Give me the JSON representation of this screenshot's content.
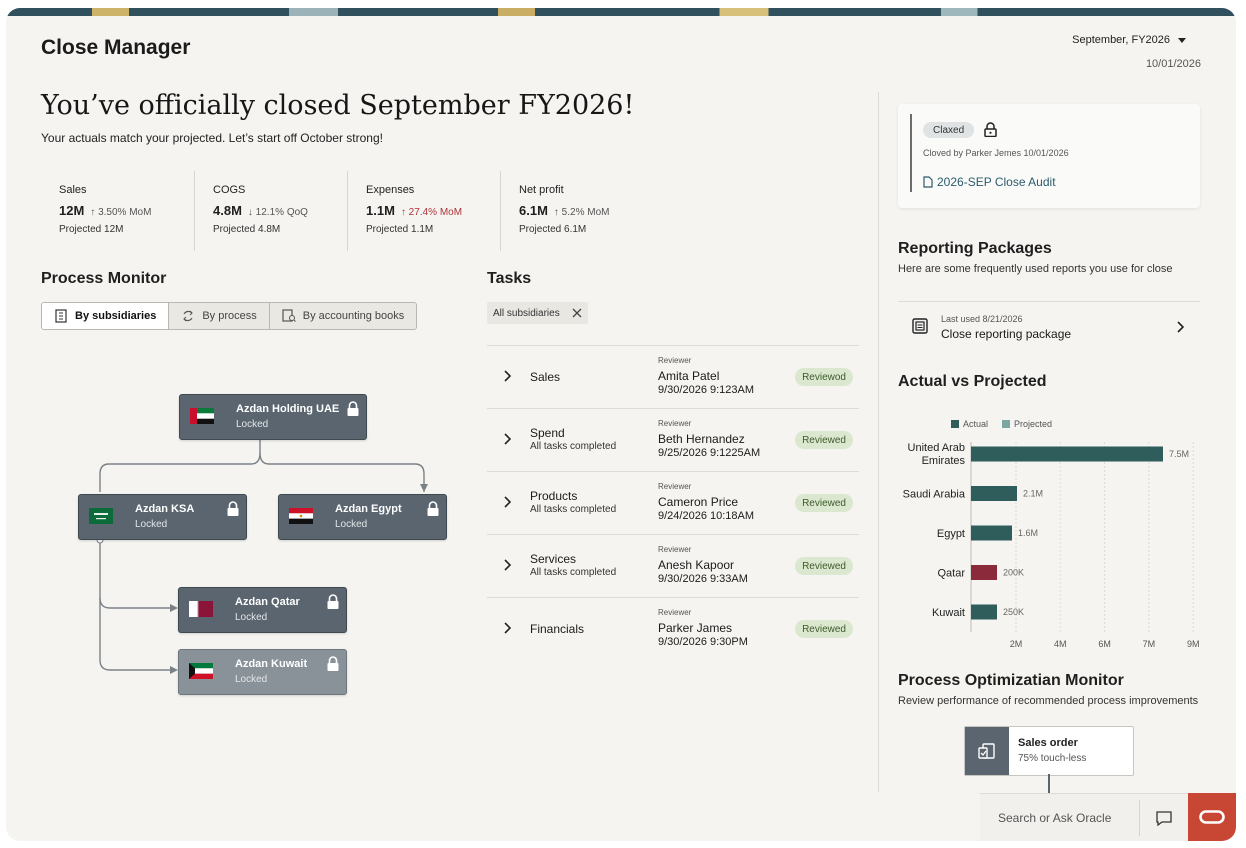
{
  "app": {
    "title": "Close Manager",
    "period": "September, FY2026",
    "date": "10/01/2026"
  },
  "hero": {
    "headline": "You’ve officially closed September FY2026!",
    "subhead": "Your actuals match your projected. Let’s start off October strong!"
  },
  "kpis": [
    {
      "label": "Sales",
      "value": "12M",
      "change": "↑ 3.50% MoM",
      "projected": "Projected 12M",
      "negative": false
    },
    {
      "label": "COGS",
      "value": "4.8M",
      "change": "↓ 12.1% QoQ",
      "projected": "Projected 4.8M",
      "negative": false
    },
    {
      "label": "Expenses",
      "value": "1.1M",
      "change": "↑ 27.4% MoM",
      "projected": "Projected 1.1M",
      "negative": true
    },
    {
      "label": "Net profit",
      "value": "6.1M",
      "change": "↑ 5.2% MoM",
      "projected": "Projected 6.1M",
      "negative": false
    }
  ],
  "process_monitor": {
    "title": "Process Monitor",
    "tabs": [
      "By subsidiaries",
      "By process",
      "By accounting books"
    ],
    "nodes": {
      "uae": {
        "name": "Azdan Holding UAE",
        "status": "Locked"
      },
      "ksa": {
        "name": "Azdan KSA",
        "status": "Locked"
      },
      "egypt": {
        "name": "Azdan Egypt",
        "status": "Locked"
      },
      "qatar": {
        "name": "Azdan Qatar",
        "status": "Locked"
      },
      "kuwait": {
        "name": "Azdan Kuwait",
        "status": "Locked"
      }
    }
  },
  "tasks": {
    "title": "Tasks",
    "filter": "All subsidiaries",
    "rows": [
      {
        "name": "Sales",
        "sub": "",
        "reviewer_label": "Reviewer",
        "reviewer": "Amita Patel",
        "date": "9/30/2026 9:123AM",
        "status": "Reviewod"
      },
      {
        "name": "Spend",
        "sub": "All tasks completed",
        "reviewer_label": "Reviewer",
        "reviewer": "Beth Hernandez",
        "date": "9/25/2026 9:1225AM",
        "status": "Reviewed"
      },
      {
        "name": "Products",
        "sub": "All tasks completed",
        "reviewer_label": "Reviewer",
        "reviewer": "Cameron Price",
        "date": "9/24/2026 10:18AM",
        "status": "Reviewed"
      },
      {
        "name": "Services",
        "sub": "All tasks completed",
        "reviewer_label": "Reviewer",
        "reviewer": "Anesh Kapoor",
        "date": "9/30/2026 9:33AM",
        "status": "Reviewed"
      },
      {
        "name": "Financials",
        "sub": "",
        "reviewer_label": "Reviewer",
        "reviewer": "Parker James",
        "date": "9/30/2026 9:30PM",
        "status": "Reviewed"
      }
    ]
  },
  "close_card": {
    "status": "Claxed",
    "by": "Cloved by Parker Jemes 10/01/2026",
    "doc": "2026-SEP Close Audit"
  },
  "reporting": {
    "title": "Reporting Packages",
    "subtitle": "Here are some frequently used reports you use for close",
    "item": {
      "last_used": "Last used 8/21/2026",
      "name": "Close reporting package"
    }
  },
  "chart_title": "Actual vs Projected",
  "chart_data": {
    "type": "bar",
    "orientation": "horizontal",
    "legend": [
      "Actual",
      "Projected"
    ],
    "legend_placement": "top",
    "categories": [
      "United Arab Emirates",
      "Saudi Arabia",
      "Egypt",
      "Qatar",
      "Kuwait"
    ],
    "values": [
      7.5,
      2.1,
      1.6,
      0.2,
      0.25
    ],
    "value_labels": [
      "7.5M",
      "2.1M",
      "1.6M",
      "200K",
      "250K"
    ],
    "bar_colors": [
      "#2f5d5b",
      "#2f5d5b",
      "#2f5d5b",
      "#8b2a3a",
      "#2f5d5b"
    ],
    "x_ticks": [
      "2M",
      "4M",
      "6M",
      "7M",
      "9M"
    ],
    "grid": true
  },
  "pom": {
    "title": "Process Optimizatian Monitor",
    "subtitle": "Review performance of recommended process improvements",
    "node_title": "Sales order",
    "node_sub": "75% touch-less"
  },
  "search": {
    "placeholder": "Search or Ask Oracle"
  },
  "colors": {
    "accent": "#2f5d5b",
    "node": "#5a6570",
    "oracle_red": "#c74634",
    "badge": "#dbe8cf"
  }
}
